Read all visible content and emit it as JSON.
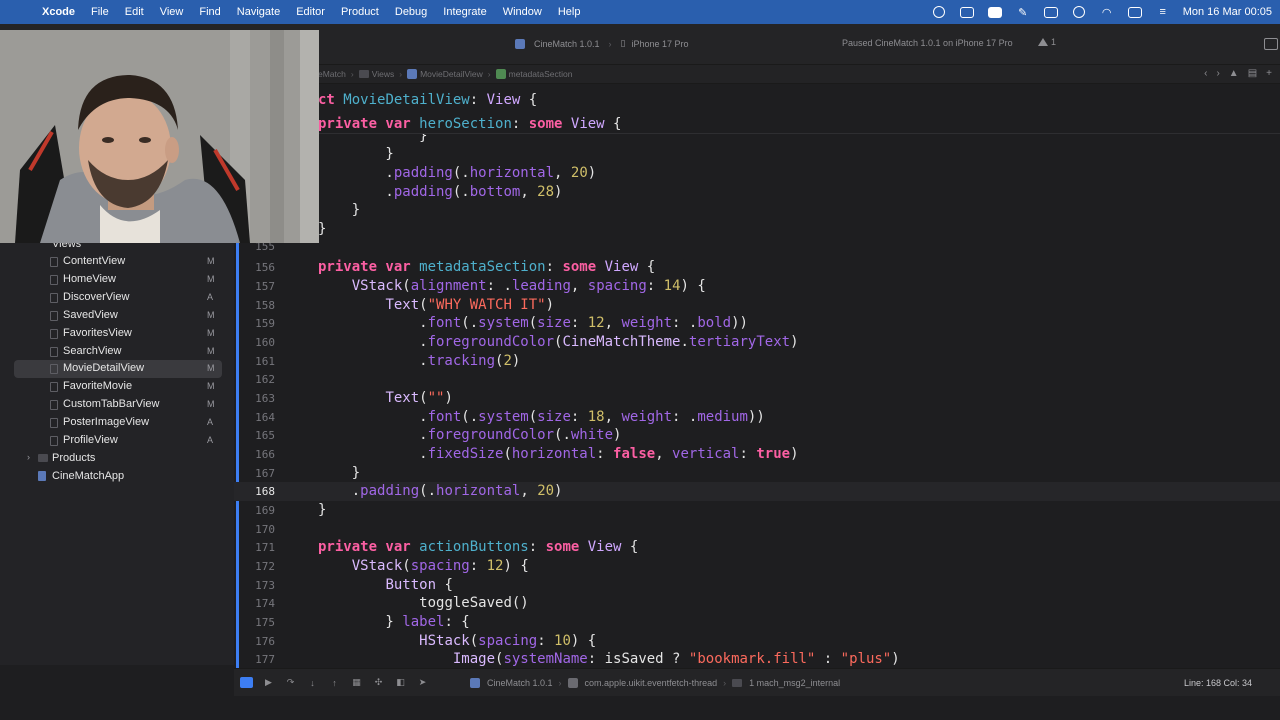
{
  "menubar": {
    "app_name": "Xcode",
    "items": [
      "File",
      "Edit",
      "View",
      "Find",
      "Navigate",
      "Editor",
      "Product",
      "Debug",
      "Integrate",
      "Window",
      "Help"
    ],
    "clock": "Mon 16 Mar  00:05"
  },
  "toolbar": {
    "scheme": "CineMatch 1.0.1",
    "destination": "iPhone 17 Pro",
    "run_status": "Paused CineMatch 1.0.1 on iPhone 17 Pro",
    "warning_count": "1"
  },
  "jumpbar": {
    "crumbs": [
      "eMatch",
      "Views",
      "MovieDetailView",
      "metadataSection"
    ]
  },
  "sticky_header": {
    "line1": "ct MovieDetailView: View {",
    "line2": "private var heroSection: some View {"
  },
  "upper_code": [
    "        }",
    "        }",
    "        .padding(.horizontal, 20)",
    "        .padding(.bottom, 28)",
    "    }",
    "}"
  ],
  "navigator": {
    "group_views": "Views",
    "files": [
      {
        "name": "ContentView",
        "status": "M"
      },
      {
        "name": "HomeView",
        "status": "M"
      },
      {
        "name": "DiscoverView",
        "status": "A"
      },
      {
        "name": "SavedView",
        "status": "M"
      },
      {
        "name": "FavoritesView",
        "status": "M"
      },
      {
        "name": "SearchView",
        "status": "M"
      },
      {
        "name": "MovieDetailView",
        "status": "M"
      },
      {
        "name": "FavoriteMovie",
        "status": "M"
      },
      {
        "name": "CustomTabBarView",
        "status": "M"
      },
      {
        "name": "PosterImageView",
        "status": "A"
      },
      {
        "name": "ProfileView",
        "status": "A"
      }
    ],
    "group_products": "Products",
    "app_file": "CineMatchApp"
  },
  "editor": {
    "current_line": 168,
    "line_numbers": [
      "155",
      "156",
      "157",
      "158",
      "159",
      "160",
      "161",
      "162",
      "163",
      "164",
      "165",
      "166",
      "167",
      "168",
      "169",
      "170",
      "171",
      "172",
      "173",
      "174",
      "175",
      "176",
      "177"
    ]
  },
  "debugbar": {
    "scheme": "CineMatch 1.0.1",
    "thread": "com.apple.uikit.eventfetch-thread",
    "frame": "1 mach_msg2_internal",
    "cursor": "Line: 168  Col: 34"
  },
  "colors": {
    "menubar": "#2a5fae",
    "accent": "#3d7ef3",
    "keyword": "#fc5fa3",
    "string": "#fc6a5d",
    "number": "#d0bf69",
    "type": "#d0a8ff",
    "declaration": "#4eb0cc"
  }
}
